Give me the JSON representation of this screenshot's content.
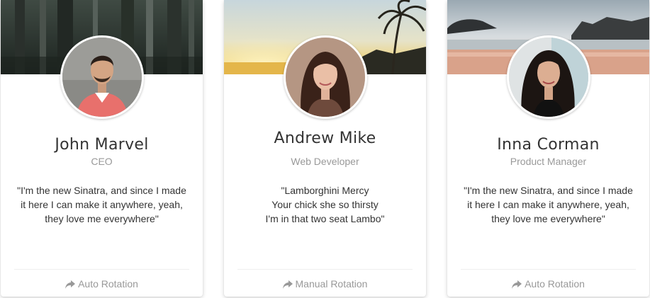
{
  "cards": [
    {
      "name": "John Marvel",
      "role": "CEO",
      "quote": [
        "\"I'm the new Sinatra, and since I made",
        "it here I can make it anywhere, yeah,",
        "they love me everywhere\""
      ],
      "footer": "Auto Rotation",
      "cover_theme": "forest",
      "icon": "share-icon"
    },
    {
      "name": "Andrew Mike",
      "role": "Web Developer",
      "quote": [
        "\"Lamborghini Mercy",
        "Your chick she so thirsty",
        "I'm in that two seat Lambo\""
      ],
      "footer": "Manual Rotation",
      "cover_theme": "palm-sunset",
      "icon": "share-icon"
    },
    {
      "name": "Inna Corman",
      "role": "Product Manager",
      "quote": [
        "\"I'm the new Sinatra, and since I made",
        "it here I can make it anywhere, yeah,",
        "they love me everywhere\""
      ],
      "footer": "Auto Rotation",
      "cover_theme": "beach",
      "icon": "share-icon"
    }
  ],
  "colors": {
    "text": "#333333",
    "muted": "#999999",
    "divider": "#eeeeee"
  }
}
